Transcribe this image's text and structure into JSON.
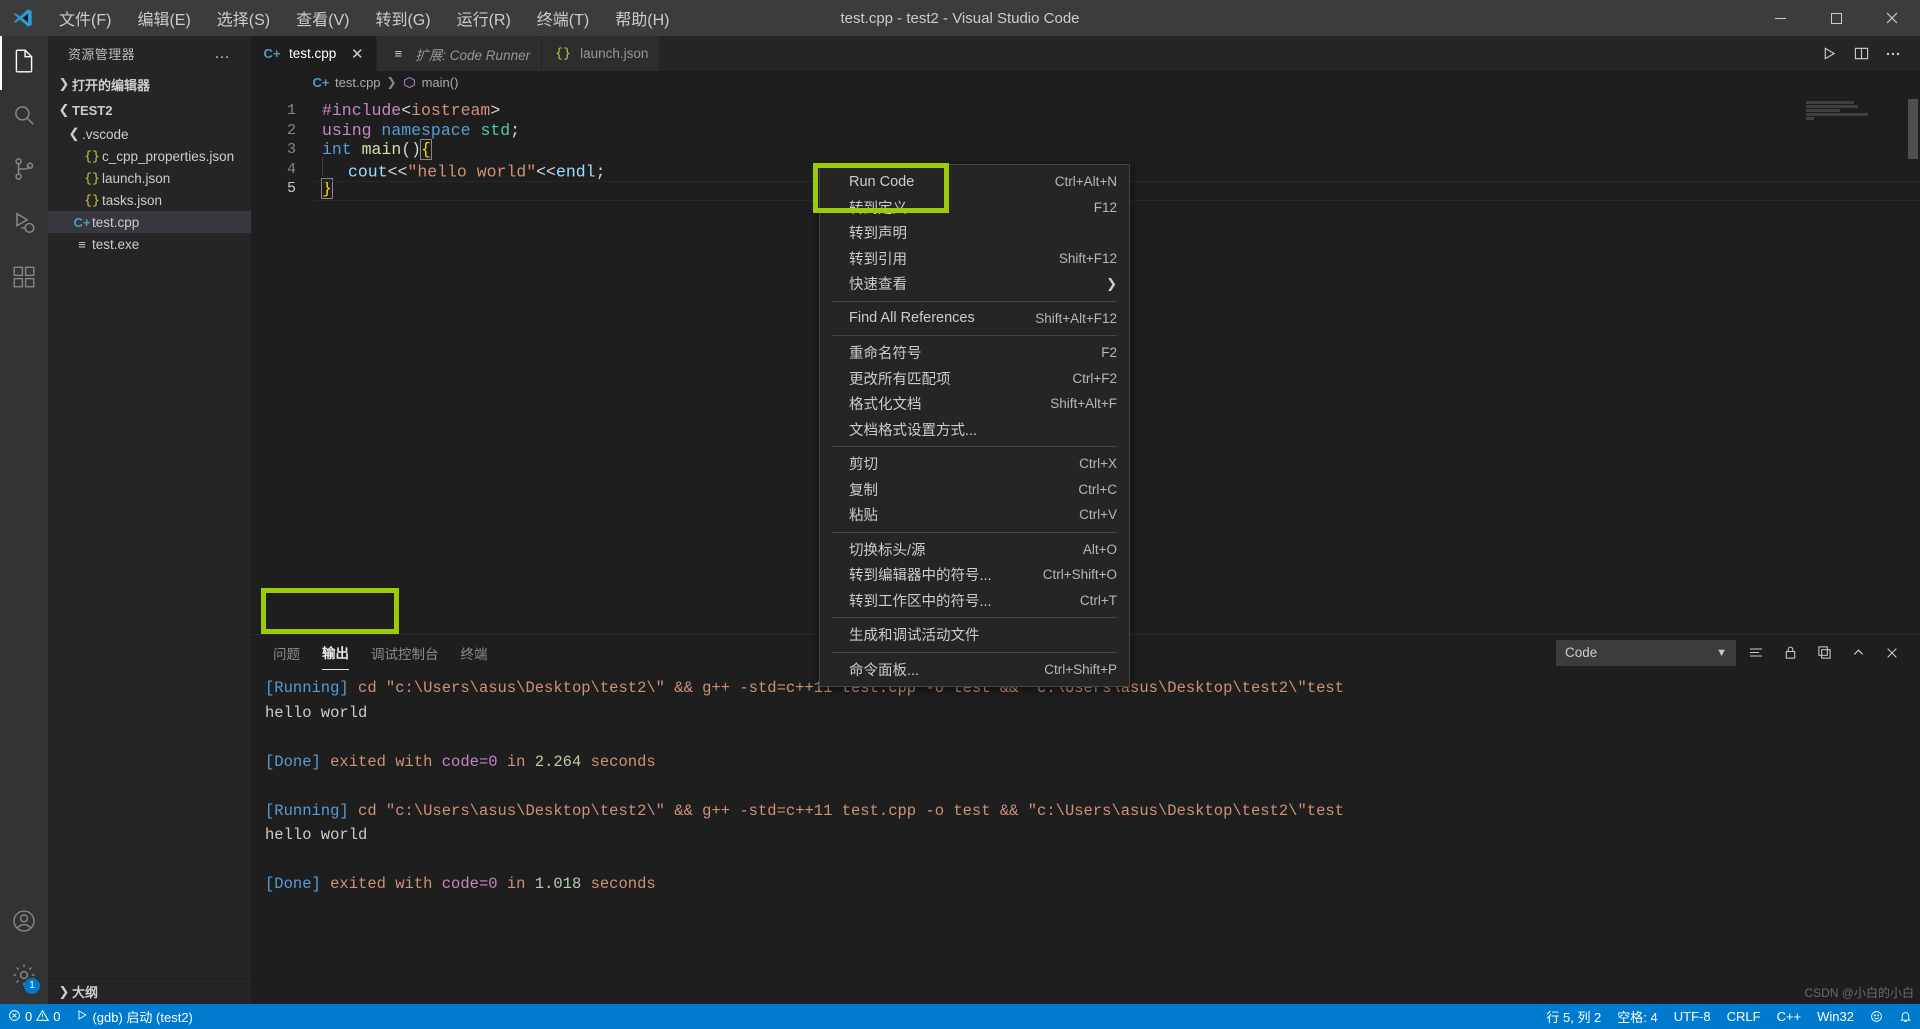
{
  "window": {
    "title": "test.cpp - test2 - Visual Studio Code",
    "logo_icon": "vscode-logo",
    "controls": [
      {
        "name": "minimize",
        "glyph": "─"
      },
      {
        "name": "maximize",
        "glyph": "☐"
      },
      {
        "name": "close",
        "glyph": "✕"
      }
    ]
  },
  "menubar": [
    {
      "label": "文件(F)"
    },
    {
      "label": "编辑(E)"
    },
    {
      "label": "选择(S)"
    },
    {
      "label": "查看(V)"
    },
    {
      "label": "转到(G)"
    },
    {
      "label": "运行(R)"
    },
    {
      "label": "终端(T)"
    },
    {
      "label": "帮助(H)"
    }
  ],
  "activitybar": [
    {
      "name": "explorer",
      "icon": "files-icon",
      "active": true
    },
    {
      "name": "search",
      "icon": "search-icon",
      "active": false
    },
    {
      "name": "source-control",
      "icon": "source-control-icon",
      "active": false
    },
    {
      "name": "run-debug",
      "icon": "run-debug-icon",
      "active": false
    },
    {
      "name": "extensions",
      "icon": "extensions-icon",
      "active": false
    },
    {
      "name": "accounts",
      "icon": "account-icon",
      "active": false
    },
    {
      "name": "settings",
      "icon": "gear-icon",
      "active": false,
      "badge": "1"
    }
  ],
  "sidebar": {
    "title": "资源管理器",
    "more_actions": "…",
    "open_editors": {
      "label": "打开的编辑器",
      "expanded": false
    },
    "workspace": {
      "label": "TEST2",
      "expanded": true
    },
    "tree": [
      {
        "label": ".vscode",
        "icon": "folder-icon",
        "depth": 1,
        "expanded": true,
        "selected": false
      },
      {
        "label": "c_cpp_properties.json",
        "icon": "json-icon",
        "depth": 2,
        "selected": false
      },
      {
        "label": "launch.json",
        "icon": "json-icon",
        "depth": 2,
        "selected": false
      },
      {
        "label": "tasks.json",
        "icon": "json-icon",
        "depth": 2,
        "selected": false
      },
      {
        "label": "test.cpp",
        "icon": "cpp-icon",
        "depth": 1,
        "selected": true
      },
      {
        "label": "test.exe",
        "icon": "binary-icon",
        "depth": 1,
        "selected": false
      }
    ],
    "outline": {
      "label": "大纲",
      "expanded": false
    }
  },
  "editor": {
    "tabs": [
      {
        "label": "test.cpp",
        "icon": "cpp-icon",
        "active": true,
        "italic": false,
        "closable": true
      },
      {
        "label": "扩展: Code Runner",
        "icon": "extension-icon",
        "active": false,
        "italic": true,
        "closable": false
      },
      {
        "label": "launch.json",
        "icon": "json-icon",
        "active": false,
        "italic": false,
        "closable": false
      }
    ],
    "tab_actions": [
      {
        "name": "run-code-button",
        "glyph": "▷"
      },
      {
        "name": "split-editor-button",
        "glyph": "◫"
      },
      {
        "name": "more-actions-button",
        "glyph": "⋯"
      }
    ],
    "breadcrumb": [
      {
        "label": "test.cpp",
        "icon": "cpp-icon"
      },
      {
        "label": "main()",
        "icon": "symbol-method-icon"
      }
    ],
    "lines": [
      {
        "num": "1",
        "text": "#include<iostream>"
      },
      {
        "num": "2",
        "text": "using namespace std;"
      },
      {
        "num": "3",
        "text": "int main(){"
      },
      {
        "num": "4",
        "text": "    cout<<\"hello world\"<<endl;"
      },
      {
        "num": "5",
        "text": "}"
      }
    ]
  },
  "context_menu": {
    "items": [
      {
        "label": "Run Code",
        "key": "Ctrl+Alt+N",
        "highlighted": true
      },
      {
        "label": "转到定义",
        "key": "F12"
      },
      {
        "label": "转到声明",
        "key": ""
      },
      {
        "label": "转到引用",
        "key": "Shift+F12"
      },
      {
        "label": "快速查看",
        "key": "",
        "submenu": true
      },
      {
        "separator": true
      },
      {
        "label": "Find All References",
        "key": "Shift+Alt+F12"
      },
      {
        "separator": true
      },
      {
        "label": "重命名符号",
        "key": "F2"
      },
      {
        "label": "更改所有匹配项",
        "key": "Ctrl+F2"
      },
      {
        "label": "格式化文档",
        "key": "Shift+Alt+F"
      },
      {
        "label": "文档格式设置方式...",
        "key": ""
      },
      {
        "separator": true
      },
      {
        "label": "剪切",
        "key": "Ctrl+X"
      },
      {
        "label": "复制",
        "key": "Ctrl+C"
      },
      {
        "label": "粘贴",
        "key": "Ctrl+V"
      },
      {
        "separator": true
      },
      {
        "label": "切换标头/源",
        "key": "Alt+O"
      },
      {
        "label": "转到编辑器中的符号...",
        "key": "Ctrl+Shift+O"
      },
      {
        "label": "转到工作区中的符号...",
        "key": "Ctrl+T"
      },
      {
        "separator": true
      },
      {
        "label": "生成和调试活动文件",
        "key": ""
      },
      {
        "separator": true
      },
      {
        "label": "命令面板...",
        "key": "Ctrl+Shift+P"
      }
    ]
  },
  "panel": {
    "tabs": [
      {
        "label": "问题",
        "active": false
      },
      {
        "label": "输出",
        "active": true
      },
      {
        "label": "调试控制台",
        "active": false
      },
      {
        "label": "终端",
        "active": false
      }
    ],
    "channel": "Code",
    "actions": [
      {
        "name": "clear-output-button",
        "glyph": "≡"
      },
      {
        "name": "lock-scroll-button",
        "glyph": "ὑ2"
      },
      {
        "name": "open-in-editor-button",
        "glyph": "⧉"
      },
      {
        "name": "maximize-panel-button",
        "glyph": "⌃"
      },
      {
        "name": "close-panel-button",
        "glyph": "✕"
      }
    ],
    "output": [
      {
        "type": "running",
        "tag": "[Running]",
        "cmd": " cd \"c:\\Users\\asus\\Desktop\\test2\\\" && g++ -std=c++11 test.cpp",
        "tail": " -o test && \"c:\\Users\\asus\\Desktop\\test2\\\"test"
      },
      {
        "type": "plain",
        "text": "hello world"
      },
      {
        "type": "blank",
        "text": ""
      },
      {
        "type": "done",
        "tag": "[Done]",
        "mid": " exited with ",
        "code": "code=0",
        "inmid": " in ",
        "num": "2.264",
        "unit": " seconds"
      },
      {
        "type": "blank",
        "text": ""
      },
      {
        "type": "running",
        "tag": "[Running]",
        "cmd": " cd \"c:\\Users\\asus\\Desktop\\test2\\\" && g++ -std=c++11 test.cpp",
        "tail": " -o test && \"c:\\Users\\asus\\Desktop\\test2\\\"test"
      },
      {
        "type": "plain",
        "text": "hello world"
      },
      {
        "type": "blank",
        "text": ""
      },
      {
        "type": "done",
        "tag": "[Done]",
        "mid": " exited with ",
        "code": "code=0",
        "inmid": " in ",
        "num": "1.018",
        "unit": " seconds"
      }
    ]
  },
  "statusbar": {
    "left": [
      {
        "name": "problems",
        "icon": "error-warning",
        "label": "0  0",
        "errors": "0",
        "warnings": "0"
      },
      {
        "name": "debug-launch",
        "label": "(gdb) 启动 (test2)"
      }
    ],
    "right": [
      {
        "name": "cursor-position",
        "label": "行 5, 列 2"
      },
      {
        "name": "indentation",
        "label": "空格: 4"
      },
      {
        "name": "encoding",
        "label": "UTF-8"
      },
      {
        "name": "eol",
        "label": "CRLF"
      },
      {
        "name": "language-mode",
        "label": "C++"
      },
      {
        "name": "win32-indicator",
        "label": "Win32"
      },
      {
        "name": "feedback",
        "label": "☺"
      },
      {
        "name": "notifications",
        "label": "🔔"
      }
    ]
  },
  "highlights": {
    "accent": "#9acd08",
    "boxes": [
      {
        "name": "run-code-highlight"
      },
      {
        "name": "hello-world-output-highlight"
      }
    ]
  },
  "watermark": {
    "text": "CSDN @小白的小白"
  }
}
